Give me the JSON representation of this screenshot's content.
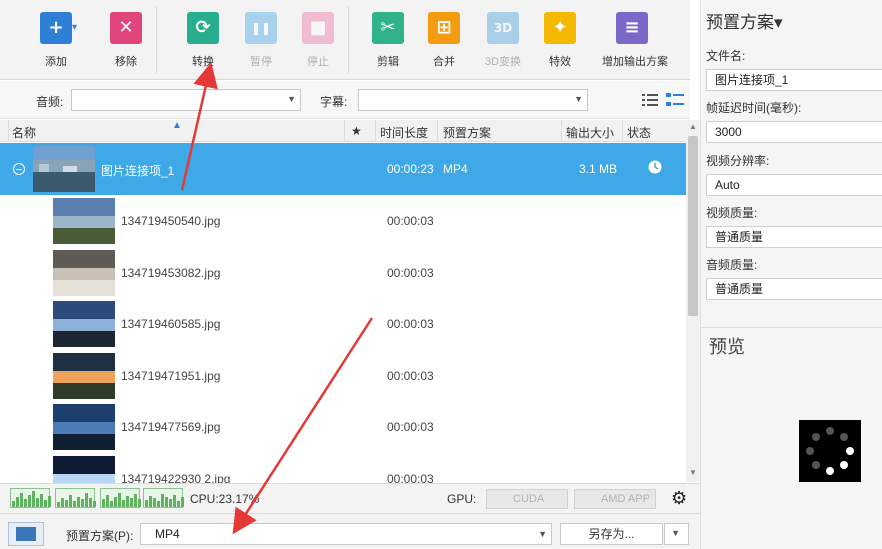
{
  "toolbar": {
    "buttons": [
      {
        "label": "添加",
        "glyph": "+",
        "color": "#2e7fd6",
        "icon": "add-icon"
      },
      {
        "label": "移除",
        "glyph": "✕",
        "color": "#e0457b",
        "icon": "remove-icon"
      },
      {
        "label": "转换",
        "glyph": "⟳",
        "color": "#27ae8e",
        "icon": "convert-icon"
      },
      {
        "label": "暂停",
        "glyph": "❚❚",
        "color": "#3aa0e6",
        "icon": "pause-icon"
      },
      {
        "label": "停止",
        "glyph": "■",
        "color": "#f06aa4",
        "icon": "stop-icon"
      },
      {
        "label": "剪辑",
        "glyph": "✂",
        "color": "#2fb38a",
        "icon": "scissors-icon"
      },
      {
        "label": "合并",
        "glyph": "⊞",
        "color": "#f39c12",
        "icon": "merge-icon"
      },
      {
        "label": "3D变换",
        "glyph": "3D",
        "color": "#3a98d8",
        "icon": "3d-icon"
      },
      {
        "label": "特效",
        "glyph": "✦",
        "color": "#f5b800",
        "icon": "effects-icon"
      },
      {
        "label": "增加输出方案",
        "glyph": "≡",
        "color": "#7b68c8",
        "icon": "add-output-icon"
      }
    ]
  },
  "filters": {
    "audio_label": "音频:",
    "subtitle_label": "字幕:"
  },
  "table": {
    "headers": {
      "name": "名称",
      "star": "★",
      "duration": "时间长度",
      "preset": "预置方案",
      "size": "输出大小",
      "status": "状态"
    },
    "group": {
      "name": "图片连接项_1",
      "duration": "00:00:23",
      "preset": "MP4",
      "size": "3.1 MB"
    },
    "items": [
      {
        "name": "134719450540.jpg",
        "duration": "00:00:03"
      },
      {
        "name": "134719453082.jpg",
        "duration": "00:00:03"
      },
      {
        "name": "134719460585.jpg",
        "duration": "00:00:03"
      },
      {
        "name": "134719471951.jpg",
        "duration": "00:00:03"
      },
      {
        "name": "134719477569.jpg",
        "duration": "00:00:03"
      },
      {
        "name": "134719422930 2.jpg",
        "duration": "00:00:03"
      }
    ]
  },
  "status": {
    "cpu": "CPU:23.17%",
    "gpu_label": "GPU:",
    "cuda": "CUDA",
    "amd": "AMD APP"
  },
  "bottom": {
    "preset_label": "预置方案(P):",
    "preset_value": "MP4",
    "save_as": "另存为..."
  },
  "panel": {
    "title": "预置方案▾",
    "filename_label": "文件名:",
    "filename_value": "图片连接项_1",
    "frame_delay_label": "帧延迟时间(毫秒):",
    "frame_delay_value": "3000",
    "resolution_label": "视频分辨率:",
    "resolution_value": "Auto",
    "video_quality_label": "视频质量:",
    "video_quality_value": "普通质量",
    "audio_quality_label": "音频质量:",
    "audio_quality_value": "普通质量",
    "preview_label": "预览"
  }
}
